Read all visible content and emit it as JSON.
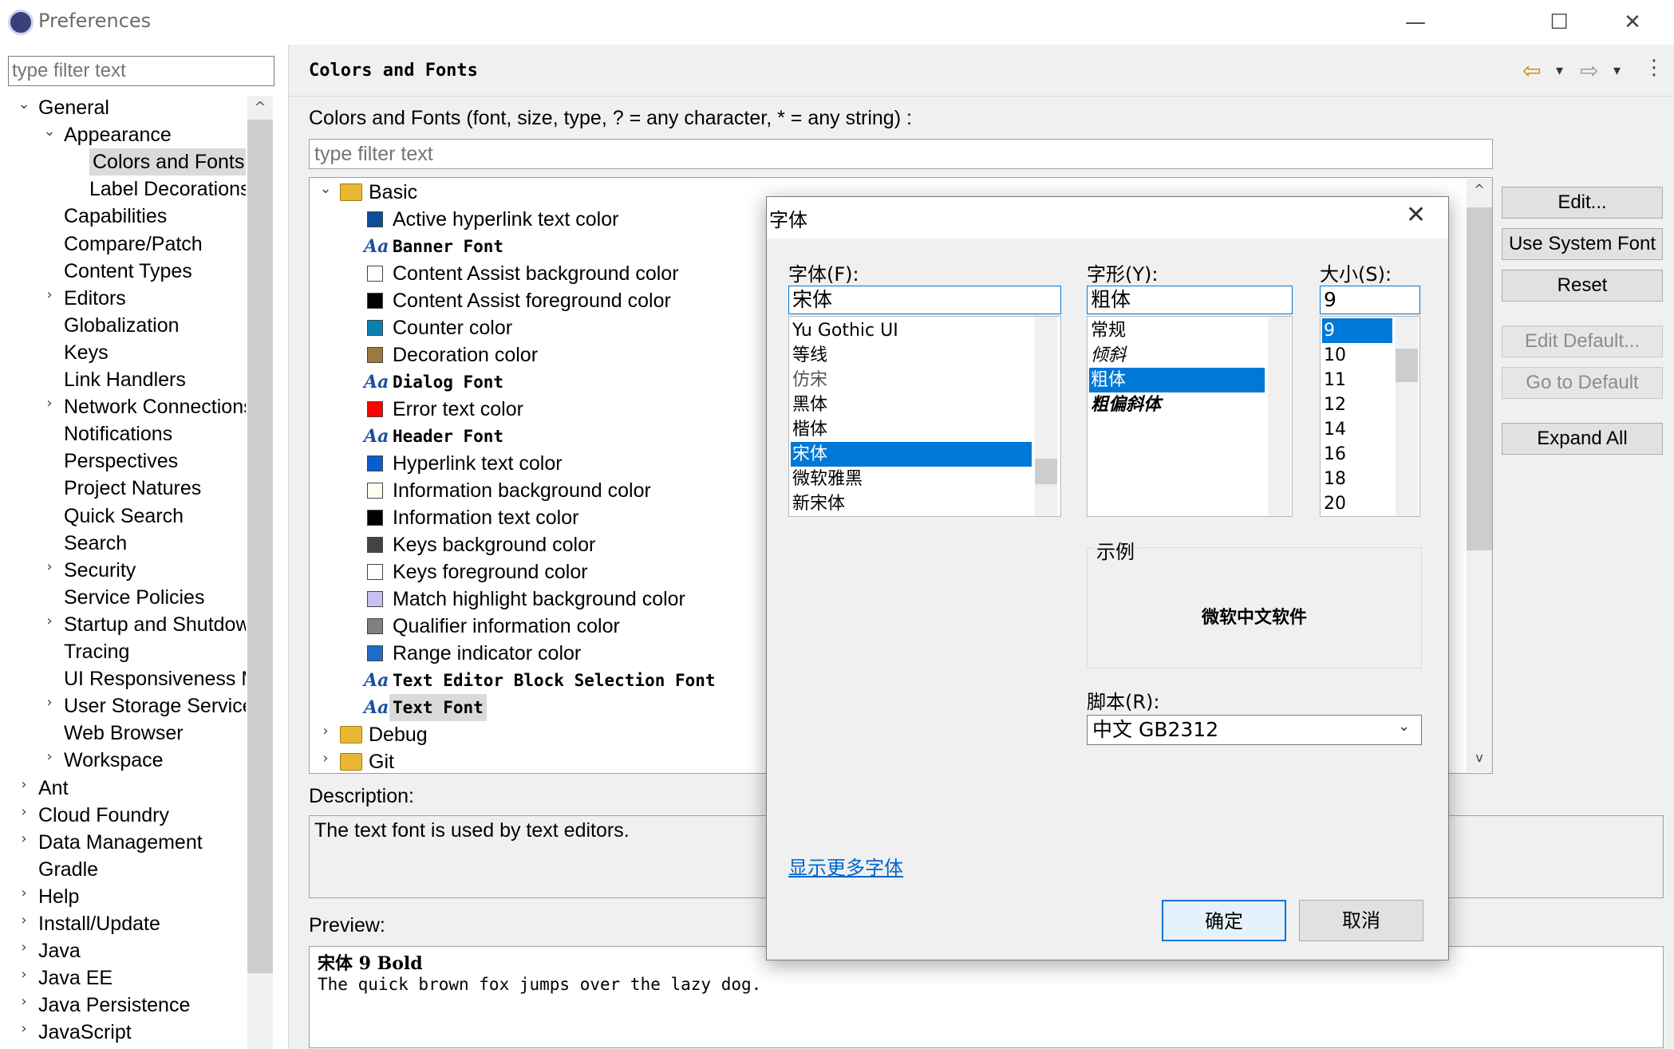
{
  "window": {
    "title": "Preferences",
    "minimize_icon": "—",
    "maximize_icon": "☐",
    "close_icon": "✕"
  },
  "tree": {
    "filter_placeholder": "type filter text",
    "items": [
      {
        "label": "General",
        "arrow": "⌄"
      },
      {
        "label": "Appearance",
        "arrow": "⌄"
      },
      {
        "label": "Colors and Fonts",
        "arrow": ""
      },
      {
        "label": "Label Decorations",
        "arrow": ""
      },
      {
        "label": "Capabilities",
        "arrow": ""
      },
      {
        "label": "Compare/Patch",
        "arrow": ""
      },
      {
        "label": "Content Types",
        "arrow": ""
      },
      {
        "label": "Editors",
        "arrow": "›"
      },
      {
        "label": "Globalization",
        "arrow": ""
      },
      {
        "label": "Keys",
        "arrow": ""
      },
      {
        "label": "Link Handlers",
        "arrow": ""
      },
      {
        "label": "Network Connections",
        "arrow": "›"
      },
      {
        "label": "Notifications",
        "arrow": ""
      },
      {
        "label": "Perspectives",
        "arrow": ""
      },
      {
        "label": "Project Natures",
        "arrow": ""
      },
      {
        "label": "Quick Search",
        "arrow": ""
      },
      {
        "label": "Search",
        "arrow": ""
      },
      {
        "label": "Security",
        "arrow": "›"
      },
      {
        "label": "Service Policies",
        "arrow": ""
      },
      {
        "label": "Startup and Shutdown",
        "arrow": "›"
      },
      {
        "label": "Tracing",
        "arrow": ""
      },
      {
        "label": "UI Responsiveness Monitoring",
        "arrow": ""
      },
      {
        "label": "User Storage Service",
        "arrow": "›"
      },
      {
        "label": "Web Browser",
        "arrow": ""
      },
      {
        "label": "Workspace",
        "arrow": "›"
      },
      {
        "label": "Ant",
        "arrow": "›"
      },
      {
        "label": "Cloud Foundry",
        "arrow": "›"
      },
      {
        "label": "Data Management",
        "arrow": "›"
      },
      {
        "label": "Gradle",
        "arrow": ""
      },
      {
        "label": "Help",
        "arrow": "›"
      },
      {
        "label": "Install/Update",
        "arrow": "›"
      },
      {
        "label": "Java",
        "arrow": "›"
      },
      {
        "label": "Java EE",
        "arrow": "›"
      },
      {
        "label": "Java Persistence",
        "arrow": "›"
      },
      {
        "label": "JavaScript",
        "arrow": "›"
      }
    ]
  },
  "page": {
    "title": "Colors and Fonts",
    "back_icon": "⇦",
    "forward_icon": "⇨",
    "dropdown_icon": "▾",
    "menu_icon": "⋮",
    "filter_label": "Colors and Fonts (font, size, type, ? = any character, * = any string) :",
    "filter_placeholder": "type filter text"
  },
  "color_tree": {
    "groups": [
      {
        "label": "Basic",
        "arrow": "⌄"
      },
      {
        "label": "Debug",
        "arrow": "›"
      },
      {
        "label": "Git",
        "arrow": "›"
      }
    ],
    "font_icon_text": "Aa",
    "items": [
      {
        "label": "Active hyperlink text color",
        "kind": "color",
        "color": "#0b4f9c"
      },
      {
        "label": "Banner Font",
        "kind": "font"
      },
      {
        "label": "Content Assist background color",
        "kind": "color",
        "color": "#ffffff"
      },
      {
        "label": "Content Assist foreground color",
        "kind": "color",
        "color": "#000000"
      },
      {
        "label": "Counter color",
        "kind": "color",
        "color": "#0a80b0"
      },
      {
        "label": "Decoration color",
        "kind": "color",
        "color": "#9a7a3e"
      },
      {
        "label": "Dialog Font",
        "kind": "font"
      },
      {
        "label": "Error text color",
        "kind": "color",
        "color": "#ff0000"
      },
      {
        "label": "Header Font",
        "kind": "font"
      },
      {
        "label": "Hyperlink text color",
        "kind": "color",
        "color": "#0b5ccc"
      },
      {
        "label": "Information background color",
        "kind": "color",
        "color": "#fffff0"
      },
      {
        "label": "Information text color",
        "kind": "color",
        "color": "#000000"
      },
      {
        "label": "Keys background color",
        "kind": "color",
        "color": "#444444"
      },
      {
        "label": "Keys foreground color",
        "kind": "color",
        "color": "#ffffff"
      },
      {
        "label": "Match highlight background color",
        "kind": "color",
        "color": "#c8c0f0"
      },
      {
        "label": "Qualifier information color",
        "kind": "color",
        "color": "#808080"
      },
      {
        "label": "Range indicator color",
        "kind": "color",
        "color": "#1f6cc8"
      },
      {
        "label": "Text Editor Block Selection Font",
        "kind": "font"
      },
      {
        "label": "Text Font",
        "kind": "font"
      }
    ]
  },
  "side_buttons": {
    "edit": "Edit...",
    "use_system_font": "Use System Font",
    "reset": "Reset",
    "edit_default": "Edit Default...",
    "go_to_default": "Go to Default",
    "expand_all": "Expand All"
  },
  "description": {
    "label": "Description:",
    "text": "The text font is used by text editors."
  },
  "preview": {
    "label": "Preview:",
    "line1": "宋体 9 Bold",
    "line2": "The quick brown fox jumps over the lazy dog."
  },
  "font_dialog": {
    "title": "字体",
    "close_icon": "✕",
    "font_label": "字体(F):",
    "font_value": "宋体",
    "fonts": [
      "Yu Gothic UI",
      "等线",
      "仿宋",
      "黑体",
      "楷体",
      "宋体",
      "微软雅黑",
      "新宋体"
    ],
    "selected_font": "宋体",
    "style_label": "字形(Y):",
    "style_value": "粗体",
    "styles": [
      "常规",
      "倾斜",
      "粗体",
      "粗偏斜体"
    ],
    "selected_style": "粗体",
    "size_label": "大小(S):",
    "size_value": "9",
    "sizes": [
      "9",
      "10",
      "11",
      "12",
      "14",
      "16",
      "18",
      "20"
    ],
    "selected_size": "9",
    "sample_label": "示例",
    "sample_text": "微软中文软件",
    "script_label": "脚本(R):",
    "script_value": "中文 GB2312",
    "more_fonts_link": "显示更多字体",
    "ok": "确定",
    "cancel": "取消"
  }
}
